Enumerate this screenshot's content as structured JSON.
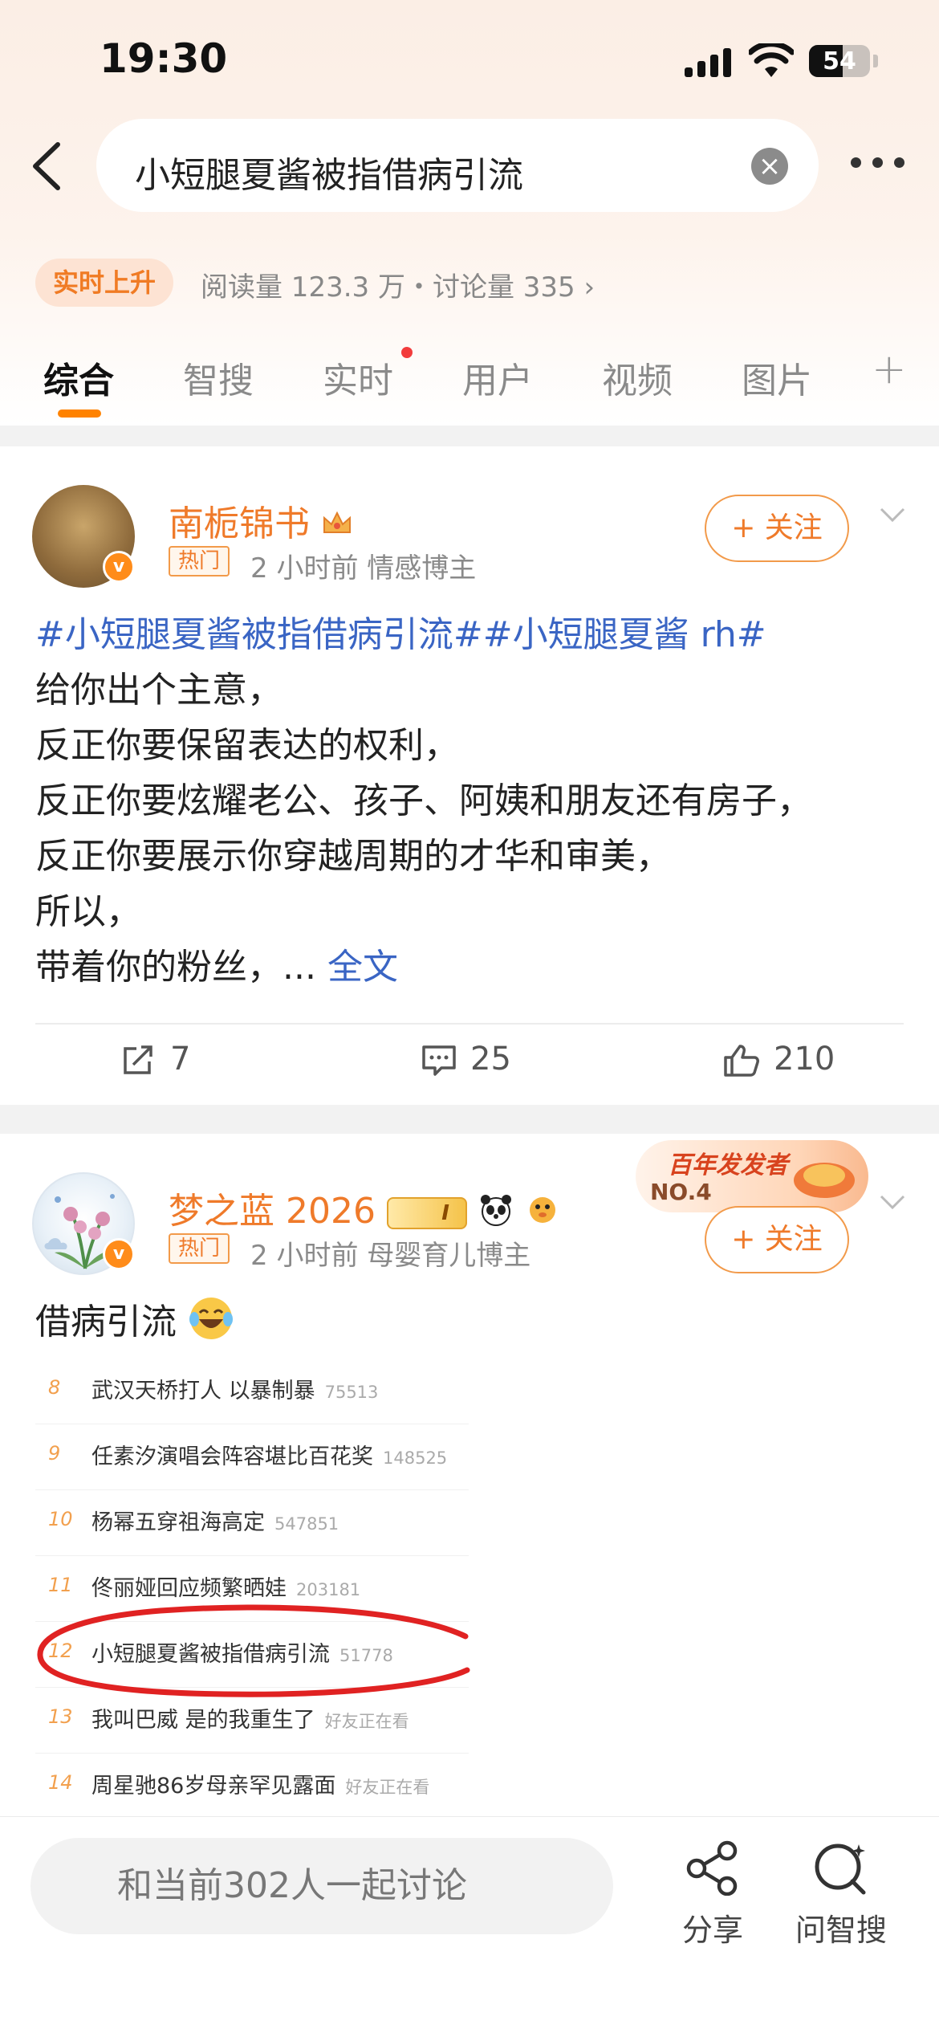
{
  "status_bar": {
    "time": "19:30",
    "battery": "54"
  },
  "search": {
    "query": "小短腿夏酱被指借病引流"
  },
  "trend": {
    "badge": "实时上升",
    "stats": "阅读量 123.3 万・讨论量 335 ›"
  },
  "tabs": [
    {
      "label": "综合"
    },
    {
      "label": "智搜"
    },
    {
      "label": "实时"
    },
    {
      "label": "用户"
    },
    {
      "label": "视频"
    },
    {
      "label": "图片"
    }
  ],
  "tab_plus": "+",
  "post1": {
    "username": "南栀锦书",
    "hot_tag": "热门",
    "meta": "2 小时前  情感博主",
    "follow_label": "+ 关注",
    "topic_line": "#小短腿夏酱被指借病引流##小短腿夏酱 rh#",
    "lines": [
      "给你出个主意，",
      "反正你要保留表达的权利，",
      "反正你要炫耀老公、孩子、阿姨和朋友还有房子，",
      "反正你要展示你穿越周期的才华和审美，",
      "所以，",
      "带着你的粉丝，..."
    ],
    "full_text_link": "全文",
    "reposts": "7",
    "comments": "25",
    "likes": "210"
  },
  "post2": {
    "username": "梦之蓝 2026",
    "level_badge": "I",
    "hot_tag": "热门",
    "meta": "2 小时前  母婴育儿博主",
    "follow_label": "+ 关注",
    "award_banner": "百年发发者",
    "award_no": "NO.4",
    "text": "借病引流",
    "embedded_list": [
      {
        "rank": "8",
        "title": "武汉天桥打人 以暴制暴",
        "count": "75513"
      },
      {
        "rank": "9",
        "title": "任素汐演唱会阵容堪比百花奖",
        "count": "148525"
      },
      {
        "rank": "10",
        "title": "杨幂五穿祖海高定",
        "count": "547851"
      },
      {
        "rank": "11",
        "title": "佟丽娅回应频繁晒娃",
        "count": "203181"
      },
      {
        "rank": "12",
        "title": "小短腿夏酱被指借病引流",
        "count": "51778"
      },
      {
        "rank": "13",
        "title": "我叫巴威 是的我重生了",
        "count": "好友正在看"
      },
      {
        "rank": "14",
        "title": "周星驰86岁母亲罕见露面",
        "count": "好友正在看"
      }
    ]
  },
  "bottom_bar": {
    "discuss_placeholder": "和当前302人一起讨论",
    "share_label": "分享",
    "ask_label": "问智搜"
  },
  "colors": {
    "accent": "#ff8200",
    "username": "#ef7a2a",
    "link": "#3a65c4",
    "hot_dot": "#f23c3c"
  }
}
